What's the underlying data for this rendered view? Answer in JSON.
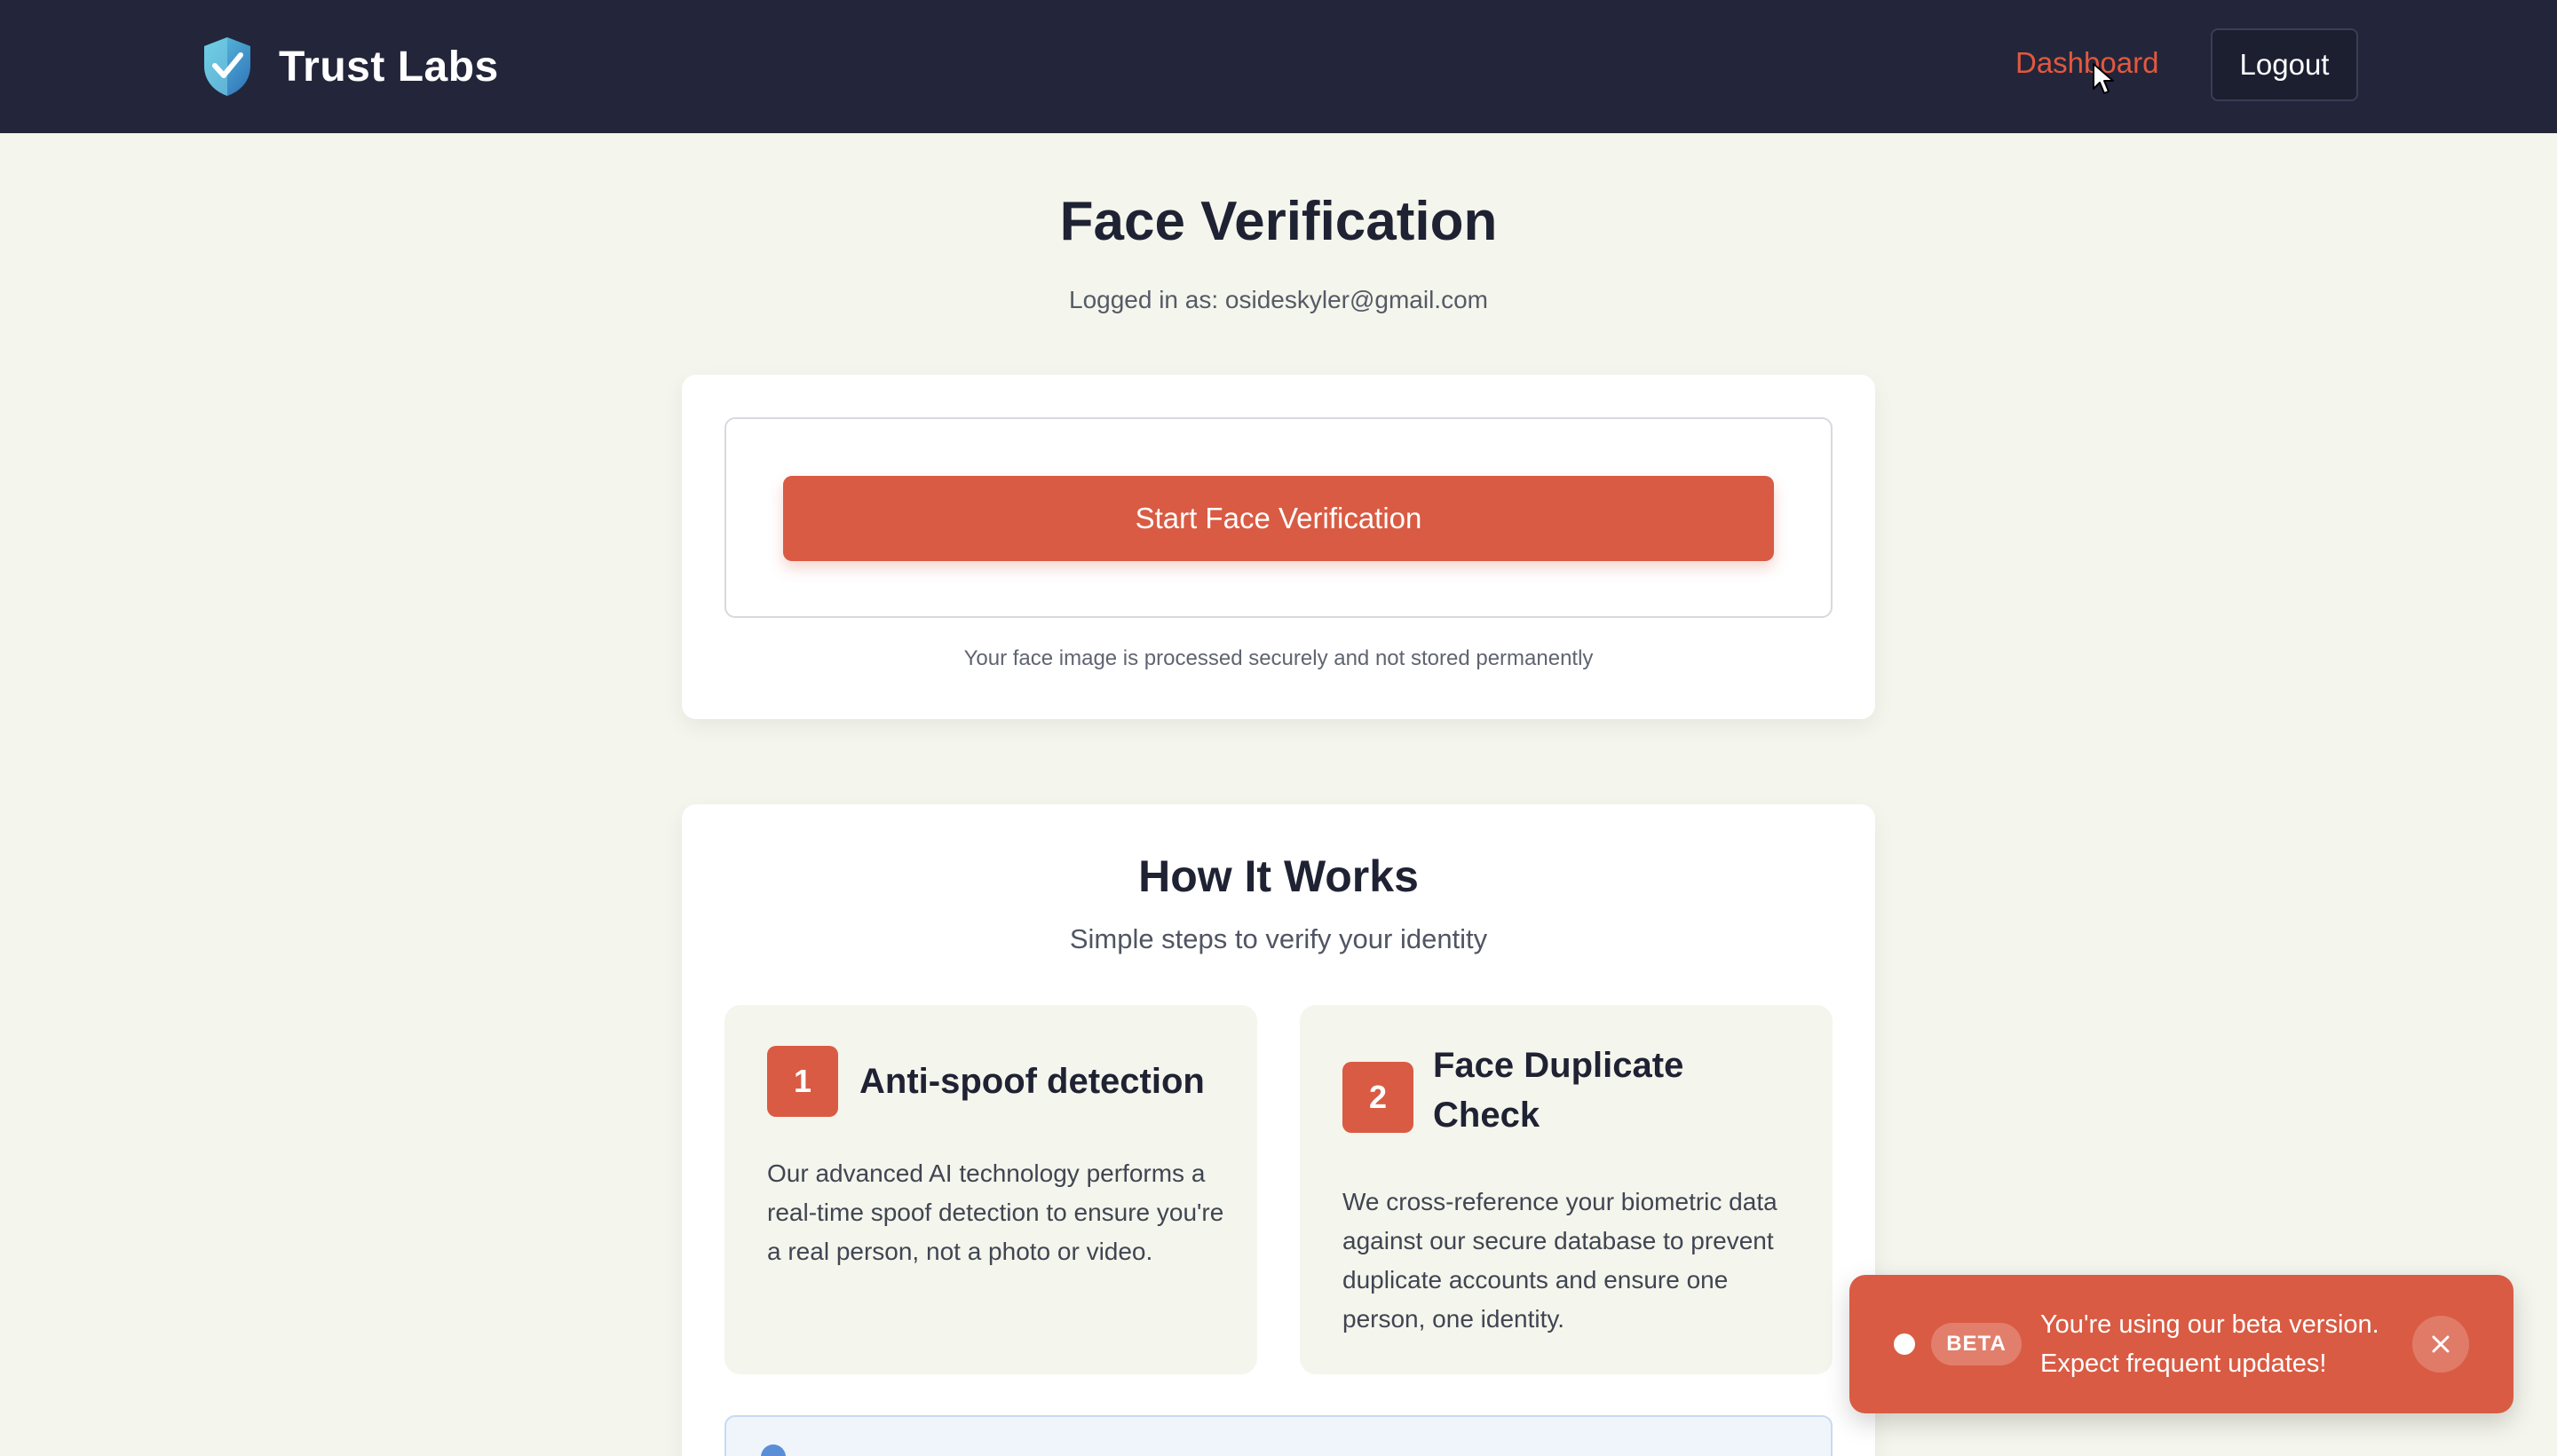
{
  "header": {
    "brand_name": "Trust Labs",
    "logo_icon": "shield-check-icon",
    "nav_dashboard": "Dashboard",
    "logout_label": "Logout"
  },
  "main": {
    "title": "Face Verification",
    "logged_in": "Logged in as: osideskyler@gmail.com",
    "start_button": "Start Face Verification",
    "secure_note": "Your face image is processed securely and not stored permanently"
  },
  "how_it_works": {
    "title": "How It Works",
    "subtitle": "Simple steps to verify your identity",
    "steps": [
      {
        "number": "1",
        "title": "Anti-spoof detection",
        "description": "Our advanced AI technology performs a real-time spoof detection to ensure you're a real person, not a photo or video."
      },
      {
        "number": "2",
        "title": "Face Duplicate Check",
        "description": "We cross-reference your biometric data against our secure database to prevent duplicate accounts and ensure one person, one identity."
      }
    ]
  },
  "toast": {
    "badge": "BETA",
    "message": "You're using our beta version. Expect frequent updates!",
    "close_icon": "close-icon"
  },
  "colors": {
    "header_bg": "#23263a",
    "accent": "#d95b43",
    "page_bg": "#f4f5ec"
  }
}
